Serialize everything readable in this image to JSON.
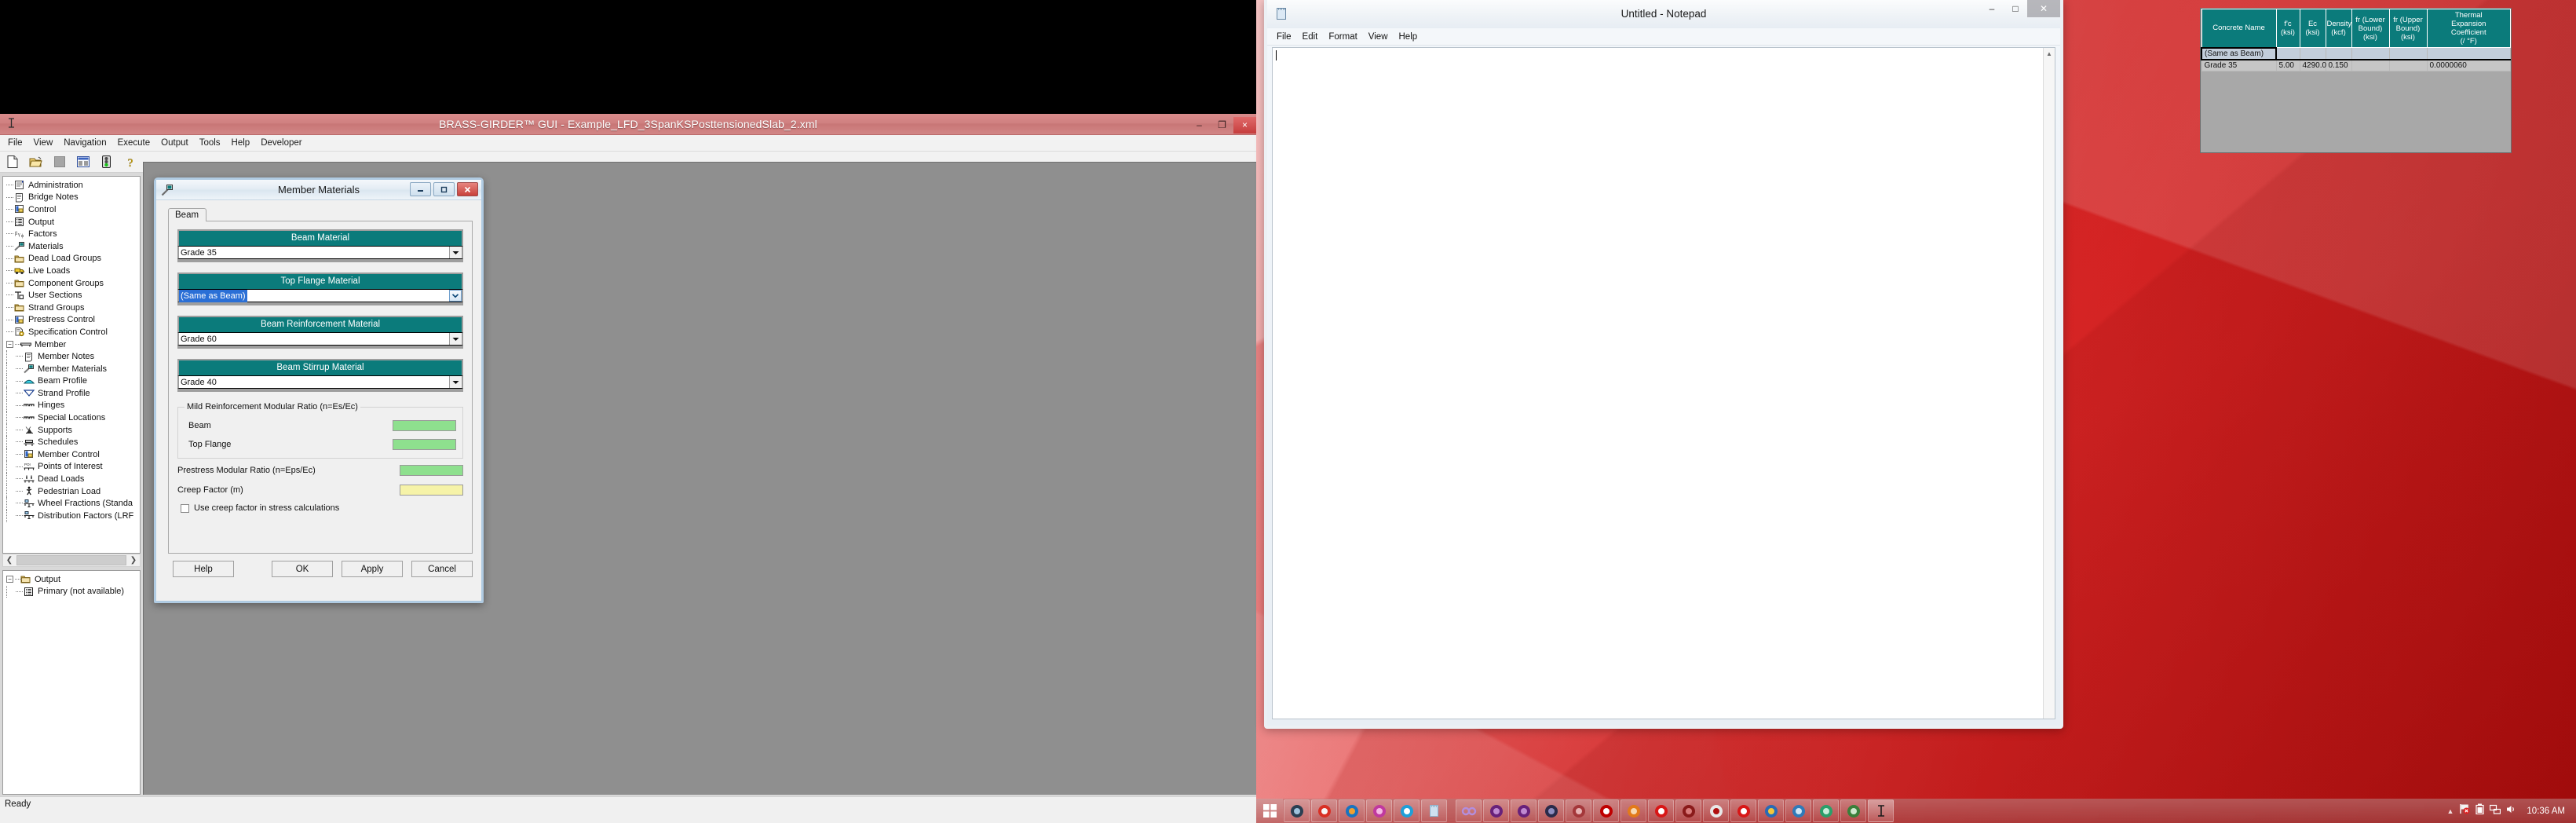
{
  "desktop": {
    "accent": "#c41f1f"
  },
  "brass_window": {
    "title": "BRASS-GIRDER™ GUI - Example_LFD_3SpanKSPosttensionedSlab_2.xml",
    "titlebar_icon": "text-cursor-icon",
    "window_buttons": [
      {
        "name": "minimize-button",
        "glyph": "–"
      },
      {
        "name": "restore-button",
        "glyph": "❐"
      },
      {
        "name": "close-button",
        "glyph": "×"
      }
    ],
    "menu": [
      "File",
      "View",
      "Navigation",
      "Execute",
      "Output",
      "Tools",
      "Help",
      "Developer"
    ],
    "toolbar": [
      {
        "name": "new-file-icon"
      },
      {
        "name": "open-folder-icon"
      },
      {
        "name": "save-icon"
      },
      {
        "name": "report-icon"
      },
      {
        "name": "traffic-light-icon"
      },
      {
        "name": "help-question-icon"
      }
    ],
    "status": "Ready",
    "tree_top": [
      {
        "label": "Administration",
        "icon": "administration-icon",
        "indent": 0
      },
      {
        "label": "Bridge Notes",
        "icon": "notes-icon",
        "indent": 0
      },
      {
        "label": "Control",
        "icon": "control-icon",
        "indent": 0
      },
      {
        "label": "Output",
        "icon": "output-list-icon",
        "indent": 0
      },
      {
        "label": "Factors",
        "icon": "factors-icon",
        "indent": 0
      },
      {
        "label": "Materials",
        "icon": "materials-icon",
        "indent": 0
      },
      {
        "label": "Dead Load Groups",
        "icon": "folder-icon",
        "indent": 0
      },
      {
        "label": "Live Loads",
        "icon": "truck-icon",
        "indent": 0
      },
      {
        "label": "Component Groups",
        "icon": "folder-icon",
        "indent": 0
      },
      {
        "label": "User Sections",
        "icon": "section-icon",
        "indent": 0
      },
      {
        "label": "Strand Groups",
        "icon": "folder-icon",
        "indent": 0
      },
      {
        "label": "Prestress Control",
        "icon": "control-icon",
        "indent": 0
      },
      {
        "label": "Specification Control",
        "icon": "spec-control-icon",
        "indent": 0
      },
      {
        "label": "Member",
        "icon": "member-icon",
        "indent": 0,
        "expander": "−"
      },
      {
        "label": "Member Notes",
        "icon": "notes-icon",
        "indent": 1
      },
      {
        "label": "Member Materials",
        "icon": "materials-icon",
        "indent": 1
      },
      {
        "label": "Beam Profile",
        "icon": "beam-profile-icon",
        "indent": 1
      },
      {
        "label": "Strand Profile",
        "icon": "strand-profile-icon",
        "indent": 1
      },
      {
        "label": "Hinges",
        "icon": "hinges-icon",
        "indent": 1
      },
      {
        "label": "Special Locations",
        "icon": "special-locations-icon",
        "indent": 1
      },
      {
        "label": "Supports",
        "icon": "supports-icon",
        "indent": 1
      },
      {
        "label": "Schedules",
        "icon": "schedules-icon",
        "indent": 1
      },
      {
        "label": "Member Control",
        "icon": "control-icon",
        "indent": 1
      },
      {
        "label": "Points of Interest",
        "icon": "points-of-interest-icon",
        "indent": 1
      },
      {
        "label": "Dead Loads",
        "icon": "dead-loads-icon",
        "indent": 1
      },
      {
        "label": "Pedestrian Load",
        "icon": "pedestrian-icon",
        "indent": 1
      },
      {
        "label": "Wheel Fractions (Standa",
        "icon": "wheel-fractions-icon",
        "indent": 1
      },
      {
        "label": "Distribution Factors (LRF",
        "icon": "distribution-factors-icon",
        "indent": 1
      }
    ],
    "tree_bottom": [
      {
        "label": "Output",
        "icon": "folder-icon",
        "indent": 0,
        "expander": "−"
      },
      {
        "label": "Primary (not available)",
        "icon": "output-list-icon",
        "indent": 1
      }
    ],
    "hscroll": {
      "left_arrow": "❮",
      "right_arrow": "❯"
    }
  },
  "member_materials_dialog": {
    "title": "Member Materials",
    "title_icon": "materials-icon",
    "window_buttons": [
      {
        "name": "minimize-button",
        "glyph": "–"
      },
      {
        "name": "restore-button",
        "glyph": "□"
      },
      {
        "name": "close-button",
        "glyph": "✕"
      }
    ],
    "tabs": [
      {
        "label": "Beam",
        "active": true
      }
    ],
    "groups": [
      {
        "header": "Beam Material",
        "value": "Grade 35",
        "selected": false,
        "arrow_style": "classic"
      },
      {
        "header": "Top Flange Material",
        "value": "(Same as Beam)",
        "selected": true,
        "arrow_style": "aero"
      },
      {
        "header": "Beam Reinforcement Material",
        "value": "Grade 60",
        "selected": false,
        "arrow_style": "classic"
      },
      {
        "header": "Beam Stirrup Material",
        "value": "Grade 40",
        "selected": false,
        "arrow_style": "classic"
      }
    ],
    "modular_group": {
      "legend": "Mild Reinforcement Modular Ratio (n=Es/Ec)",
      "rows": [
        {
          "label": "Beam",
          "value": "",
          "color": "green"
        },
        {
          "label": "Top Flange",
          "value": "",
          "color": "green"
        }
      ]
    },
    "extra_rows": [
      {
        "label": "Prestress Modular Ratio (n=Eps/Ec)",
        "value": "",
        "color": "green"
      },
      {
        "label": "Creep Factor (m)",
        "value": "",
        "color": "yellow"
      }
    ],
    "checkbox": {
      "label": "Use creep factor in stress calculations",
      "checked": false
    },
    "buttons": [
      "Help",
      "OK",
      "Apply",
      "Cancel"
    ]
  },
  "notepad": {
    "title": "Untitled - Notepad",
    "icon": "notepad-icon",
    "menu": [
      "File",
      "Edit",
      "Format",
      "View",
      "Help"
    ],
    "text": "",
    "window_buttons": [
      {
        "name": "minimize-button",
        "glyph": "–"
      },
      {
        "name": "maximize-button",
        "glyph": "□"
      },
      {
        "name": "close-button",
        "glyph": "✕"
      }
    ],
    "scroll_up_arrow": "▲"
  },
  "concrete_table": {
    "headers": [
      "Concrete Name",
      "f'c\n(ksi)",
      "Ec\n(ksi)",
      "Density\n(kcf)",
      "fr (Lower Bound)\n(ksi)",
      "fr (Upper Bound)\n(ksi)",
      "Thermal Expansion Coefficient\n(/ °F)"
    ],
    "header_lines": [
      [
        "Concrete Name"
      ],
      [
        "f'c",
        "(ksi)"
      ],
      [
        "Ec",
        "(ksi)"
      ],
      [
        "Density",
        "(kcf)"
      ],
      [
        "fr (Lower",
        "Bound)",
        "(ksi)"
      ],
      [
        "fr (Upper",
        "Bound)",
        "(ksi)"
      ],
      [
        "Thermal",
        "Expansion",
        "Coefficient",
        "(/ °F)"
      ]
    ],
    "rows": [
      {
        "selected": true,
        "cells": [
          "(Same as Beam)",
          "",
          "",
          "",
          "",
          "",
          ""
        ]
      },
      {
        "selected": false,
        "cells": [
          "Grade 35",
          "5.00",
          "4290.0",
          "0.150",
          "",
          "",
          "0.0000060"
        ]
      }
    ]
  },
  "taskbar": {
    "start": "start-orb-icon",
    "items": [
      {
        "name": "taskbar-tux-icon"
      },
      {
        "name": "taskbar-chrome-icon"
      },
      {
        "name": "taskbar-firefox-icon"
      },
      {
        "name": "taskbar-itunes-icon"
      },
      {
        "name": "taskbar-skype-icon"
      },
      {
        "name": "taskbar-notepad-icon"
      },
      {
        "name": "taskbar-infinity-icon",
        "gap_before": true
      },
      {
        "name": "taskbar-visual-studio-icon"
      },
      {
        "name": "taskbar-visual-studio-2-icon"
      },
      {
        "name": "taskbar-lock-icon"
      },
      {
        "name": "taskbar-access-icon"
      },
      {
        "name": "taskbar-filezilla-icon"
      },
      {
        "name": "taskbar-vlc-icon"
      },
      {
        "name": "taskbar-imagemagick-icon"
      },
      {
        "name": "taskbar-gimp-icon"
      },
      {
        "name": "taskbar-acrobat-icon"
      },
      {
        "name": "taskbar-imagemagick-2-icon"
      },
      {
        "name": "taskbar-paint-icon"
      },
      {
        "name": "taskbar-app-icon"
      },
      {
        "name": "taskbar-app2-icon"
      },
      {
        "name": "taskbar-app3-icon"
      },
      {
        "name": "taskbar-brass-girder-icon",
        "active": true
      }
    ],
    "tray": [
      {
        "name": "show-hidden-icons-arrow"
      },
      {
        "name": "flag-action-center-icon"
      },
      {
        "name": "battery-icon"
      },
      {
        "name": "network-icon"
      },
      {
        "name": "volume-icon"
      }
    ],
    "clock": "10:36 AM"
  }
}
